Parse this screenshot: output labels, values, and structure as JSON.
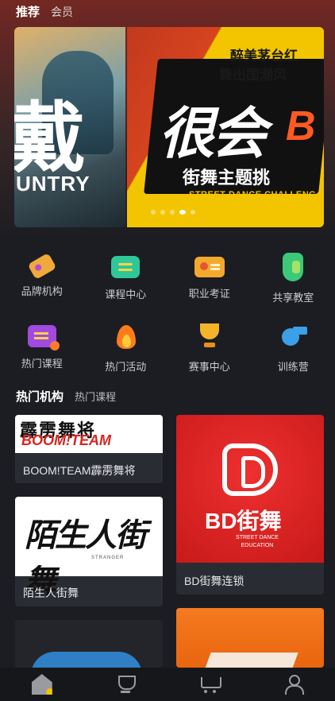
{
  "top_tabs": {
    "active": "推荐",
    "other": "会员"
  },
  "banner": {
    "left_glyph": "戴",
    "left_text": "UNTRY",
    "right_headline_1": "醉美茅台红",
    "right_headline_2": "舞出国潮风",
    "right_brush": "很会",
    "right_brush_tail": "B",
    "right_sub": "街舞主题挑",
    "right_sub_en": "STREET DANCE CHALLENG",
    "dots_total": 5,
    "dots_active": 4
  },
  "categories": [
    {
      "label": "品牌机构",
      "icon": "brand-card-icon"
    },
    {
      "label": "课程中心",
      "icon": "course-box-icon"
    },
    {
      "label": "职业考证",
      "icon": "certificate-icon"
    },
    {
      "label": "共享教室",
      "icon": "classroom-icon"
    },
    {
      "label": "热门课程",
      "icon": "hot-course-icon"
    },
    {
      "label": "热门活动",
      "icon": "fire-icon"
    },
    {
      "label": "赛事中心",
      "icon": "trophy-icon"
    },
    {
      "label": "训练营",
      "icon": "whistle-icon"
    }
  ],
  "section_tabs": {
    "active": "热门机构",
    "other": "热门课程"
  },
  "cards": [
    {
      "name": "BOOM!TEAM霹雳舞将",
      "logo_top": "霹雳舞将",
      "logo_bottom": "BOOM!TEAM"
    },
    {
      "name": "BD街舞连锁",
      "logo_text": "BD街舞",
      "logo_sub": "STREET DANCE EDUCATION"
    },
    {
      "name": "陌生人街舞",
      "logo_text": "陌生人街舞",
      "logo_sub": "STRANGER"
    }
  ],
  "bottom_nav": [
    {
      "icon": "home-icon",
      "active": true
    },
    {
      "icon": "trophy-icon",
      "active": false
    },
    {
      "icon": "cart-icon",
      "active": false
    },
    {
      "icon": "user-icon",
      "active": false
    }
  ],
  "colors": {
    "background": "#1c1d22",
    "accent_yellow": "#f2c500",
    "bd_red": "#d82020"
  }
}
